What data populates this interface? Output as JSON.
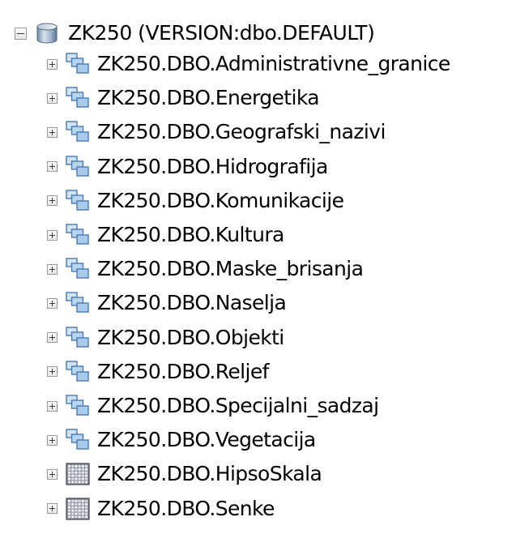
{
  "tree": {
    "root": {
      "label": "ZK250 (VERSION:dbo.DEFAULT)",
      "icon": "database-icon",
      "expander": "minus"
    },
    "children": [
      {
        "label": "ZK250.DBO.Administrativne_granice",
        "icon": "feature-dataset-icon"
      },
      {
        "label": "ZK250.DBO.Energetika",
        "icon": "feature-dataset-icon"
      },
      {
        "label": "ZK250.DBO.Geografski_nazivi",
        "icon": "feature-dataset-icon"
      },
      {
        "label": "ZK250.DBO.Hidrografija",
        "icon": "feature-dataset-icon"
      },
      {
        "label": "ZK250.DBO.Komunikacije",
        "icon": "feature-dataset-icon"
      },
      {
        "label": "ZK250.DBO.Kultura",
        "icon": "feature-dataset-icon"
      },
      {
        "label": "ZK250.DBO.Maske_brisanja",
        "icon": "feature-dataset-icon"
      },
      {
        "label": "ZK250.DBO.Naselja",
        "icon": "feature-dataset-icon"
      },
      {
        "label": "ZK250.DBO.Objekti",
        "icon": "feature-dataset-icon"
      },
      {
        "label": "ZK250.DBO.Reljef",
        "icon": "feature-dataset-icon"
      },
      {
        "label": "ZK250.DBO.Specijalni_sadzaj",
        "icon": "feature-dataset-icon"
      },
      {
        "label": "ZK250.DBO.Vegetacija",
        "icon": "feature-dataset-icon"
      },
      {
        "label": "ZK250.DBO.HipsoSkala",
        "icon": "raster-dataset-icon"
      },
      {
        "label": "ZK250.DBO.Senke",
        "icon": "raster-dataset-icon"
      }
    ]
  }
}
